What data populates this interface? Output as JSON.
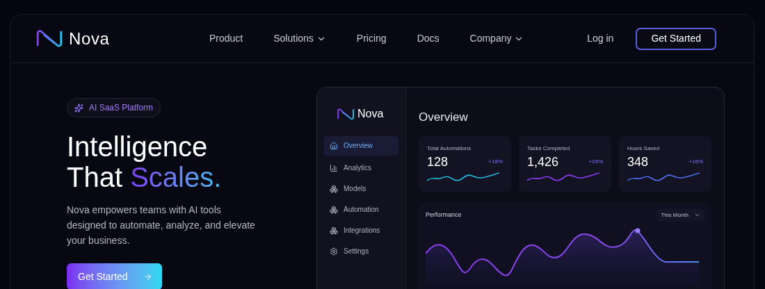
{
  "brand": {
    "name": "Nova"
  },
  "nav": [
    {
      "label": "Product",
      "dropdown": false
    },
    {
      "label": "Solutions",
      "dropdown": true
    },
    {
      "label": "Pricing",
      "dropdown": false
    },
    {
      "label": "Docs",
      "dropdown": false
    },
    {
      "label": "Company",
      "dropdown": true
    }
  ],
  "login": "Log in",
  "header_cta": "Get Started",
  "hero": {
    "badge": "AI SaaS Platform",
    "title_line1": "Intelligence",
    "title_line2_plain": "That",
    "title_line2_accent": "Scales.",
    "description": "Nova empowers teams with AI tools designed to automate, analyze, and elevate your business.",
    "cta": "Get Started"
  },
  "dashboard": {
    "brand": "Nova",
    "title": "Overview",
    "sidebar": [
      {
        "label": "Overview",
        "kind": "home",
        "selected": true
      },
      {
        "label": "Analytics",
        "kind": "bars",
        "selected": false
      },
      {
        "label": "Models",
        "kind": "cube",
        "selected": false
      },
      {
        "label": "Automation",
        "kind": "cube",
        "selected": false
      },
      {
        "label": "Integrations",
        "kind": "cube",
        "selected": false
      },
      {
        "label": "Settings",
        "kind": "gear",
        "selected": false
      }
    ],
    "stats": [
      {
        "label": "Total Automations",
        "value": "128",
        "change": "+18%",
        "color": "#22b8e0"
      },
      {
        "label": "Tasks Completed",
        "value": "1,426",
        "change": "+24%",
        "color": "#8b3cf0"
      },
      {
        "label": "Hours Saved",
        "value": "348",
        "change": "+16%",
        "color": "#4f6cf0"
      }
    ],
    "performance": {
      "title": "Performance",
      "period": "This Month"
    }
  }
}
